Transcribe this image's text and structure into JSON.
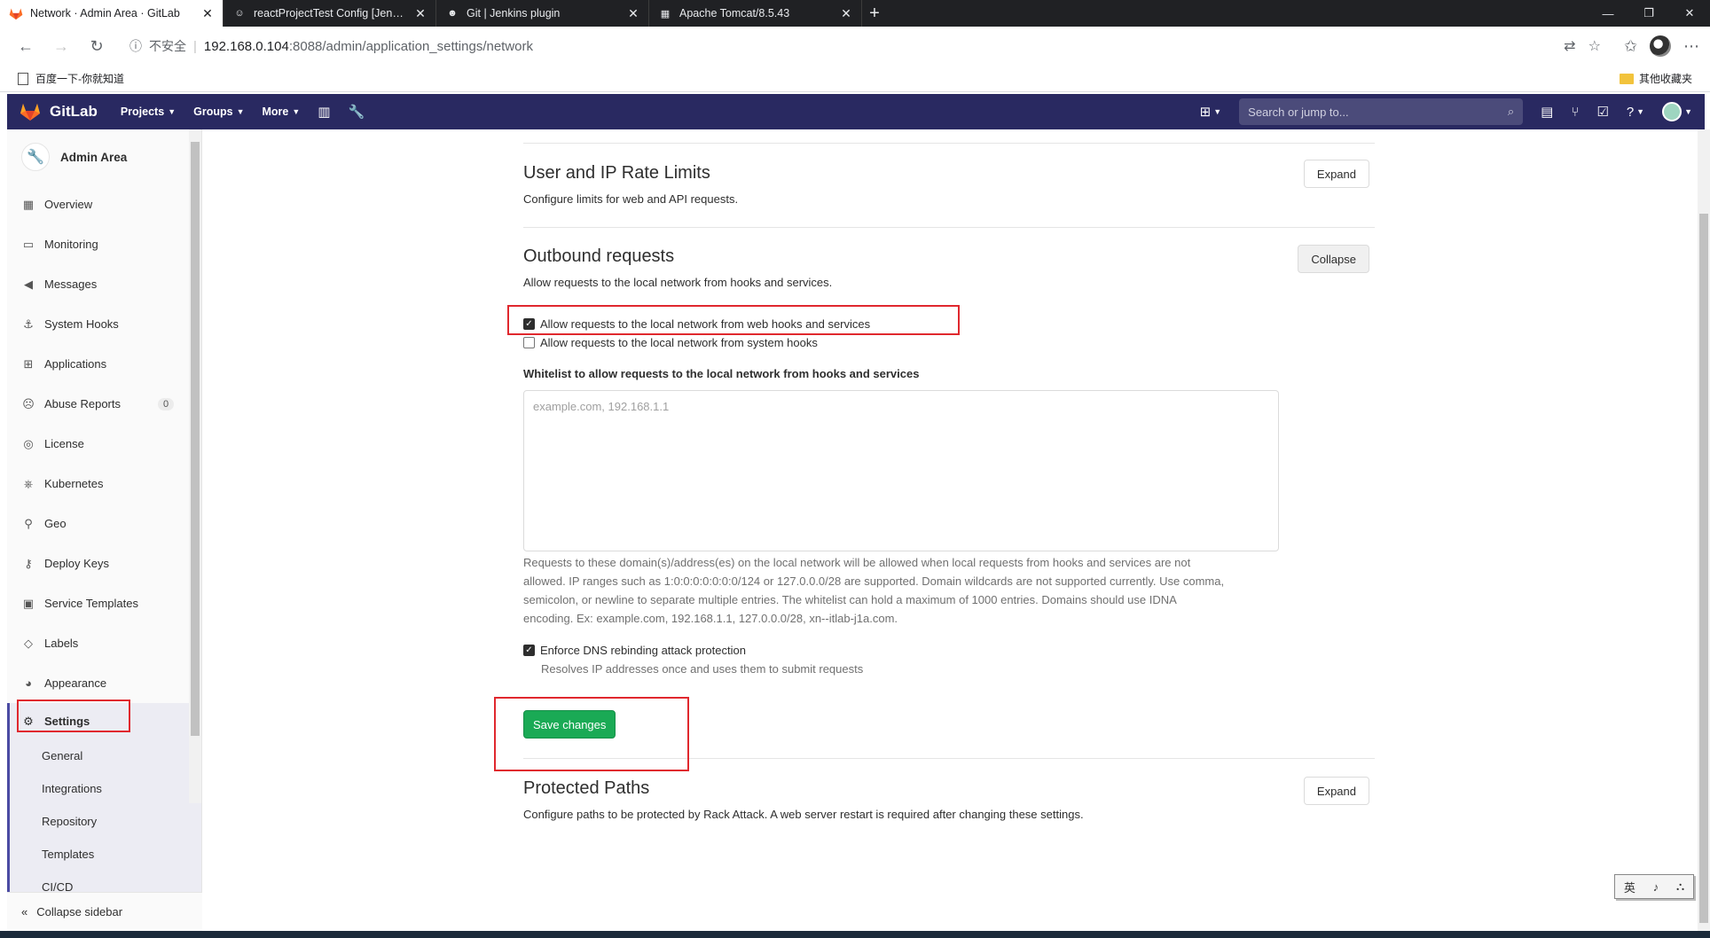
{
  "browser": {
    "tabs": [
      {
        "title": "Network · Admin Area · GitLab",
        "active": true,
        "icon": "gitlab-fox-icon"
      },
      {
        "title": "reactProjectTest Config [Jenkins]",
        "active": false,
        "icon": "jenkins-icon"
      },
      {
        "title": "Git | Jenkins plugin",
        "active": false,
        "icon": "jenkins-plugin-icon"
      },
      {
        "title": "Apache Tomcat/8.5.43",
        "active": false,
        "icon": "tomcat-icon"
      }
    ],
    "insecure_label": "不安全",
    "url_host": "192.168.0.104",
    "url_path": ":8088/admin/application_settings/network",
    "bookmark_left": "百度一下-你就知道",
    "bookmark_right": "其他收藏夹"
  },
  "header": {
    "brand": "GitLab",
    "nav": [
      "Projects",
      "Groups",
      "More"
    ],
    "search_placeholder": "Search or jump to..."
  },
  "sidebar": {
    "context_title": "Admin Area",
    "items": [
      {
        "label": "Overview",
        "icon": "grid-icon"
      },
      {
        "label": "Monitoring",
        "icon": "monitor-icon"
      },
      {
        "label": "Messages",
        "icon": "megaphone-icon"
      },
      {
        "label": "System Hooks",
        "icon": "hook-icon"
      },
      {
        "label": "Applications",
        "icon": "apps-icon"
      },
      {
        "label": "Abuse Reports",
        "icon": "face-icon",
        "count": "0"
      },
      {
        "label": "License",
        "icon": "license-icon"
      },
      {
        "label": "Kubernetes",
        "icon": "kubernetes-icon"
      },
      {
        "label": "Geo",
        "icon": "location-icon"
      },
      {
        "label": "Deploy Keys",
        "icon": "key-icon"
      },
      {
        "label": "Service Templates",
        "icon": "template-icon"
      },
      {
        "label": "Labels",
        "icon": "label-icon"
      },
      {
        "label": "Appearance",
        "icon": "palette-icon"
      }
    ],
    "active_item": "Settings",
    "sub_items": [
      "General",
      "Integrations",
      "Repository",
      "Templates",
      "CI/CD"
    ],
    "collapse_label": "Collapse sidebar"
  },
  "main": {
    "rate_limits": {
      "title": "User and IP Rate Limits",
      "description": "Configure limits for web and API requests.",
      "button": "Expand"
    },
    "outbound": {
      "title": "Outbound requests",
      "description": "Allow requests to the local network from hooks and services.",
      "button": "Collapse",
      "checkbox_web_hooks": "Allow requests to the local network from web hooks and services",
      "checkbox_web_hooks_checked": true,
      "checkbox_system_hooks": "Allow requests to the local network from system hooks",
      "checkbox_system_hooks_checked": false,
      "whitelist_label": "Whitelist to allow requests to the local network from hooks and services",
      "whitelist_placeholder": "example.com, 192.168.1.1",
      "whitelist_help_1": "Requests to these domain(s)/address(es) on the local network will be allowed when local requests from hooks and services are not",
      "whitelist_help_2": "allowed. IP ranges such as 1:0:0:0:0:0:0:0/124 or 127.0.0.0/28 are supported. Domain wildcards are not supported currently. Use comma,",
      "whitelist_help_3": "semicolon, or newline to separate multiple entries. The whitelist can hold a maximum of 1000 entries. Domains should use IDNA",
      "whitelist_help_4": "encoding. Ex: example.com, 192.168.1.1, 127.0.0.0/28, xn--itlab-j1a.com.",
      "dns_label": "Enforce DNS rebinding attack protection",
      "dns_checked": true,
      "dns_help": "Resolves IP addresses once and uses them to submit requests",
      "save_button": "Save changes"
    },
    "protected_paths": {
      "title": "Protected Paths",
      "description": "Configure paths to be protected by Rack Attack. A web server restart is required after changing these settings.",
      "button": "Expand"
    }
  },
  "ime": {
    "a": "英",
    "b": "♪",
    "c": "⛬"
  }
}
